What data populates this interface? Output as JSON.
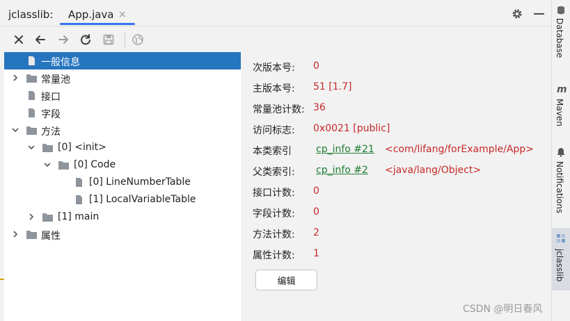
{
  "window": {
    "app_label": "jclasslib:",
    "tab_title": "App.java",
    "tab_close": "×"
  },
  "toolbar": {
    "icons": [
      "close-icon",
      "back-arrow-icon",
      "forward-arrow-icon",
      "refresh-icon",
      "save-icon",
      "browser-icon"
    ]
  },
  "tree": {
    "items": [
      {
        "label": "一般信息",
        "icon": "file-icon",
        "expanded": null,
        "selected": true
      },
      {
        "label": "常量池",
        "icon": "folder-icon",
        "expanded": false,
        "selected": false
      },
      {
        "label": "接口",
        "icon": "file-icon",
        "expanded": null,
        "selected": false
      },
      {
        "label": "字段",
        "icon": "file-icon",
        "expanded": null,
        "selected": false
      },
      {
        "label": "方法",
        "icon": "folder-icon",
        "expanded": true,
        "selected": false
      },
      {
        "label": "[0] <init>",
        "icon": "folder-icon",
        "expanded": true,
        "selected": false
      },
      {
        "label": "[0] Code",
        "icon": "folder-icon",
        "expanded": true,
        "selected": false
      },
      {
        "label": "[0] LineNumberTable",
        "icon": "file-icon",
        "expanded": null,
        "selected": false
      },
      {
        "label": "[1] LocalVariableTable",
        "icon": "file-icon",
        "expanded": null,
        "selected": false
      },
      {
        "label": "[1] main",
        "icon": "folder-icon",
        "expanded": false,
        "selected": false
      },
      {
        "label": "属性",
        "icon": "folder-icon",
        "expanded": false,
        "selected": false
      }
    ]
  },
  "general_info": {
    "rows": [
      {
        "key": "次版本号:",
        "value": "0"
      },
      {
        "key": "主版本号:",
        "value": "51 [1.7]"
      },
      {
        "key": "常量池计数:",
        "value": "36"
      },
      {
        "key": "访问标志:",
        "value": "0x0021 [public]"
      },
      {
        "key": "本类索引",
        "link": "cp_info #21",
        "ref": "<com/lifang/forExample/App>"
      },
      {
        "key": "父类索引:",
        "link": "cp_info #2",
        "ref": "<java/lang/Object>"
      },
      {
        "key": "接口计数:",
        "value": "0"
      },
      {
        "key": "字段计数:",
        "value": "0"
      },
      {
        "key": "方法计数:",
        "value": "2"
      },
      {
        "key": "属性计数:",
        "value": "1"
      }
    ],
    "edit_button": "编辑"
  },
  "side_tools": [
    {
      "label": "Database",
      "icon": "database-icon",
      "active": false
    },
    {
      "label": "Maven",
      "icon": "maven-icon",
      "active": false
    },
    {
      "label": "Notifications",
      "icon": "bell-icon",
      "active": false
    },
    {
      "label": "jclasslib",
      "icon": "jclasslib-icon",
      "active": true
    }
  ],
  "watermark": "CSDN @明日春风",
  "colors": {
    "selection": "#2675bf",
    "value_red": "#c62828",
    "link_green": "#1e7d32",
    "tab_underline": "#3574f0"
  }
}
